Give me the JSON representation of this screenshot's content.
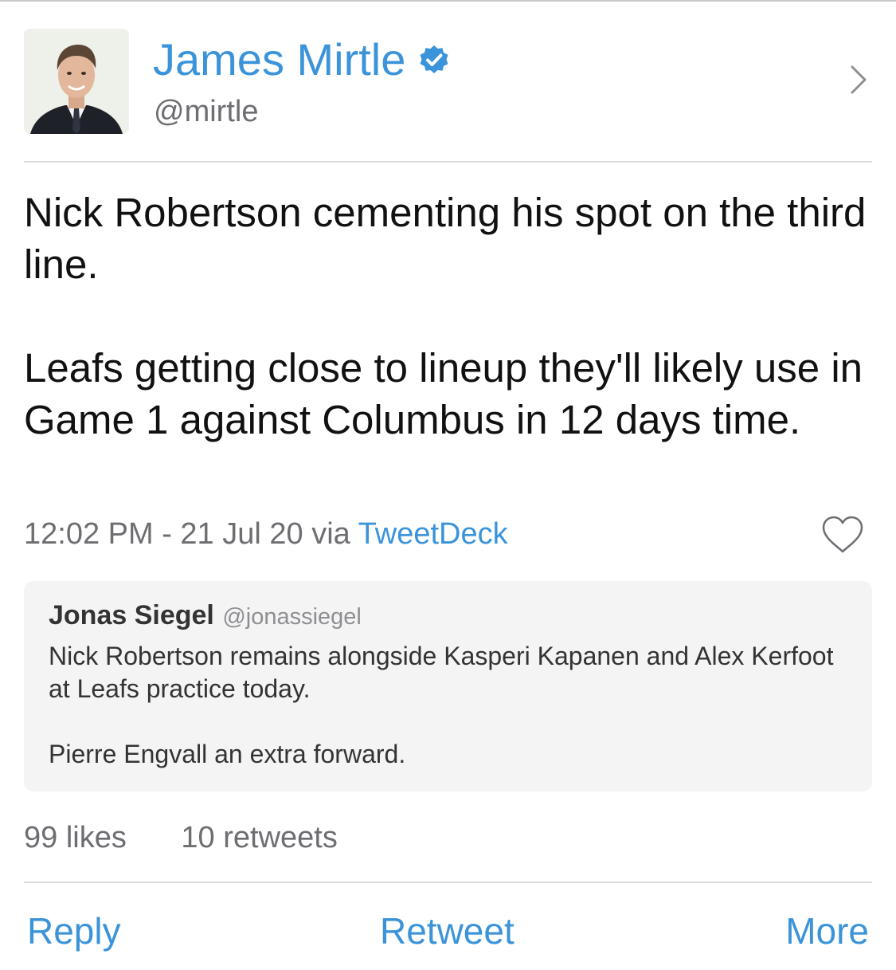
{
  "author": {
    "name": "James Mirtle",
    "handle": "@mirtle",
    "verified": true
  },
  "tweet": {
    "paragraphs": [
      "Nick Robertson cementing his spot on the third line.",
      "Leafs getting close to lineup they'll likely use in Game 1 against Columbus in 12 days time."
    ],
    "timestamp": "12:02 PM - 21 Jul 20",
    "via": "via",
    "source": "TweetDeck"
  },
  "quoted": {
    "name": "Jonas Siegel",
    "handle": "@jonassiegel",
    "paragraphs": [
      "Nick Robertson remains alongside Kasperi Kapanen and Alex Kerfoot at Leafs practice today.",
      "Pierre Engvall an extra forward."
    ]
  },
  "stats": {
    "likes": "99 likes",
    "retweets": "10 retweets"
  },
  "actions": {
    "reply": "Reply",
    "retweet": "Retweet",
    "more": "More"
  },
  "icons": {
    "verified": "verified-badge-icon",
    "chevron": "chevron-right-icon",
    "like": "heart-outline-icon"
  },
  "colors": {
    "link": "#3b94d9",
    "secondary_text": "#6d6d72",
    "quote_background": "#f4f4f4"
  }
}
